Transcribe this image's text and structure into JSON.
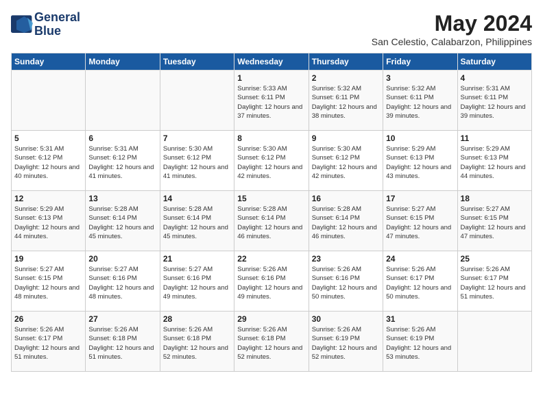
{
  "logo": {
    "line1": "General",
    "line2": "Blue"
  },
  "title": "May 2024",
  "location": "San Celestio, Calabarzon, Philippines",
  "days_header": [
    "Sunday",
    "Monday",
    "Tuesday",
    "Wednesday",
    "Thursday",
    "Friday",
    "Saturday"
  ],
  "weeks": [
    [
      {
        "day": "",
        "info": ""
      },
      {
        "day": "",
        "info": ""
      },
      {
        "day": "",
        "info": ""
      },
      {
        "day": "1",
        "info": "Sunrise: 5:33 AM\nSunset: 6:11 PM\nDaylight: 12 hours\nand 37 minutes."
      },
      {
        "day": "2",
        "info": "Sunrise: 5:32 AM\nSunset: 6:11 PM\nDaylight: 12 hours\nand 38 minutes."
      },
      {
        "day": "3",
        "info": "Sunrise: 5:32 AM\nSunset: 6:11 PM\nDaylight: 12 hours\nand 39 minutes."
      },
      {
        "day": "4",
        "info": "Sunrise: 5:31 AM\nSunset: 6:11 PM\nDaylight: 12 hours\nand 39 minutes."
      }
    ],
    [
      {
        "day": "5",
        "info": "Sunrise: 5:31 AM\nSunset: 6:12 PM\nDaylight: 12 hours\nand 40 minutes."
      },
      {
        "day": "6",
        "info": "Sunrise: 5:31 AM\nSunset: 6:12 PM\nDaylight: 12 hours\nand 41 minutes."
      },
      {
        "day": "7",
        "info": "Sunrise: 5:30 AM\nSunset: 6:12 PM\nDaylight: 12 hours\nand 41 minutes."
      },
      {
        "day": "8",
        "info": "Sunrise: 5:30 AM\nSunset: 6:12 PM\nDaylight: 12 hours\nand 42 minutes."
      },
      {
        "day": "9",
        "info": "Sunrise: 5:30 AM\nSunset: 6:12 PM\nDaylight: 12 hours\nand 42 minutes."
      },
      {
        "day": "10",
        "info": "Sunrise: 5:29 AM\nSunset: 6:13 PM\nDaylight: 12 hours\nand 43 minutes."
      },
      {
        "day": "11",
        "info": "Sunrise: 5:29 AM\nSunset: 6:13 PM\nDaylight: 12 hours\nand 44 minutes."
      }
    ],
    [
      {
        "day": "12",
        "info": "Sunrise: 5:29 AM\nSunset: 6:13 PM\nDaylight: 12 hours\nand 44 minutes."
      },
      {
        "day": "13",
        "info": "Sunrise: 5:28 AM\nSunset: 6:14 PM\nDaylight: 12 hours\nand 45 minutes."
      },
      {
        "day": "14",
        "info": "Sunrise: 5:28 AM\nSunset: 6:14 PM\nDaylight: 12 hours\nand 45 minutes."
      },
      {
        "day": "15",
        "info": "Sunrise: 5:28 AM\nSunset: 6:14 PM\nDaylight: 12 hours\nand 46 minutes."
      },
      {
        "day": "16",
        "info": "Sunrise: 5:28 AM\nSunset: 6:14 PM\nDaylight: 12 hours\nand 46 minutes."
      },
      {
        "day": "17",
        "info": "Sunrise: 5:27 AM\nSunset: 6:15 PM\nDaylight: 12 hours\nand 47 minutes."
      },
      {
        "day": "18",
        "info": "Sunrise: 5:27 AM\nSunset: 6:15 PM\nDaylight: 12 hours\nand 47 minutes."
      }
    ],
    [
      {
        "day": "19",
        "info": "Sunrise: 5:27 AM\nSunset: 6:15 PM\nDaylight: 12 hours\nand 48 minutes."
      },
      {
        "day": "20",
        "info": "Sunrise: 5:27 AM\nSunset: 6:16 PM\nDaylight: 12 hours\nand 48 minutes."
      },
      {
        "day": "21",
        "info": "Sunrise: 5:27 AM\nSunset: 6:16 PM\nDaylight: 12 hours\nand 49 minutes."
      },
      {
        "day": "22",
        "info": "Sunrise: 5:26 AM\nSunset: 6:16 PM\nDaylight: 12 hours\nand 49 minutes."
      },
      {
        "day": "23",
        "info": "Sunrise: 5:26 AM\nSunset: 6:16 PM\nDaylight: 12 hours\nand 50 minutes."
      },
      {
        "day": "24",
        "info": "Sunrise: 5:26 AM\nSunset: 6:17 PM\nDaylight: 12 hours\nand 50 minutes."
      },
      {
        "day": "25",
        "info": "Sunrise: 5:26 AM\nSunset: 6:17 PM\nDaylight: 12 hours\nand 51 minutes."
      }
    ],
    [
      {
        "day": "26",
        "info": "Sunrise: 5:26 AM\nSunset: 6:17 PM\nDaylight: 12 hours\nand 51 minutes."
      },
      {
        "day": "27",
        "info": "Sunrise: 5:26 AM\nSunset: 6:18 PM\nDaylight: 12 hours\nand 51 minutes."
      },
      {
        "day": "28",
        "info": "Sunrise: 5:26 AM\nSunset: 6:18 PM\nDaylight: 12 hours\nand 52 minutes."
      },
      {
        "day": "29",
        "info": "Sunrise: 5:26 AM\nSunset: 6:18 PM\nDaylight: 12 hours\nand 52 minutes."
      },
      {
        "day": "30",
        "info": "Sunrise: 5:26 AM\nSunset: 6:19 PM\nDaylight: 12 hours\nand 52 minutes."
      },
      {
        "day": "31",
        "info": "Sunrise: 5:26 AM\nSunset: 6:19 PM\nDaylight: 12 hours\nand 53 minutes."
      },
      {
        "day": "",
        "info": ""
      }
    ]
  ]
}
